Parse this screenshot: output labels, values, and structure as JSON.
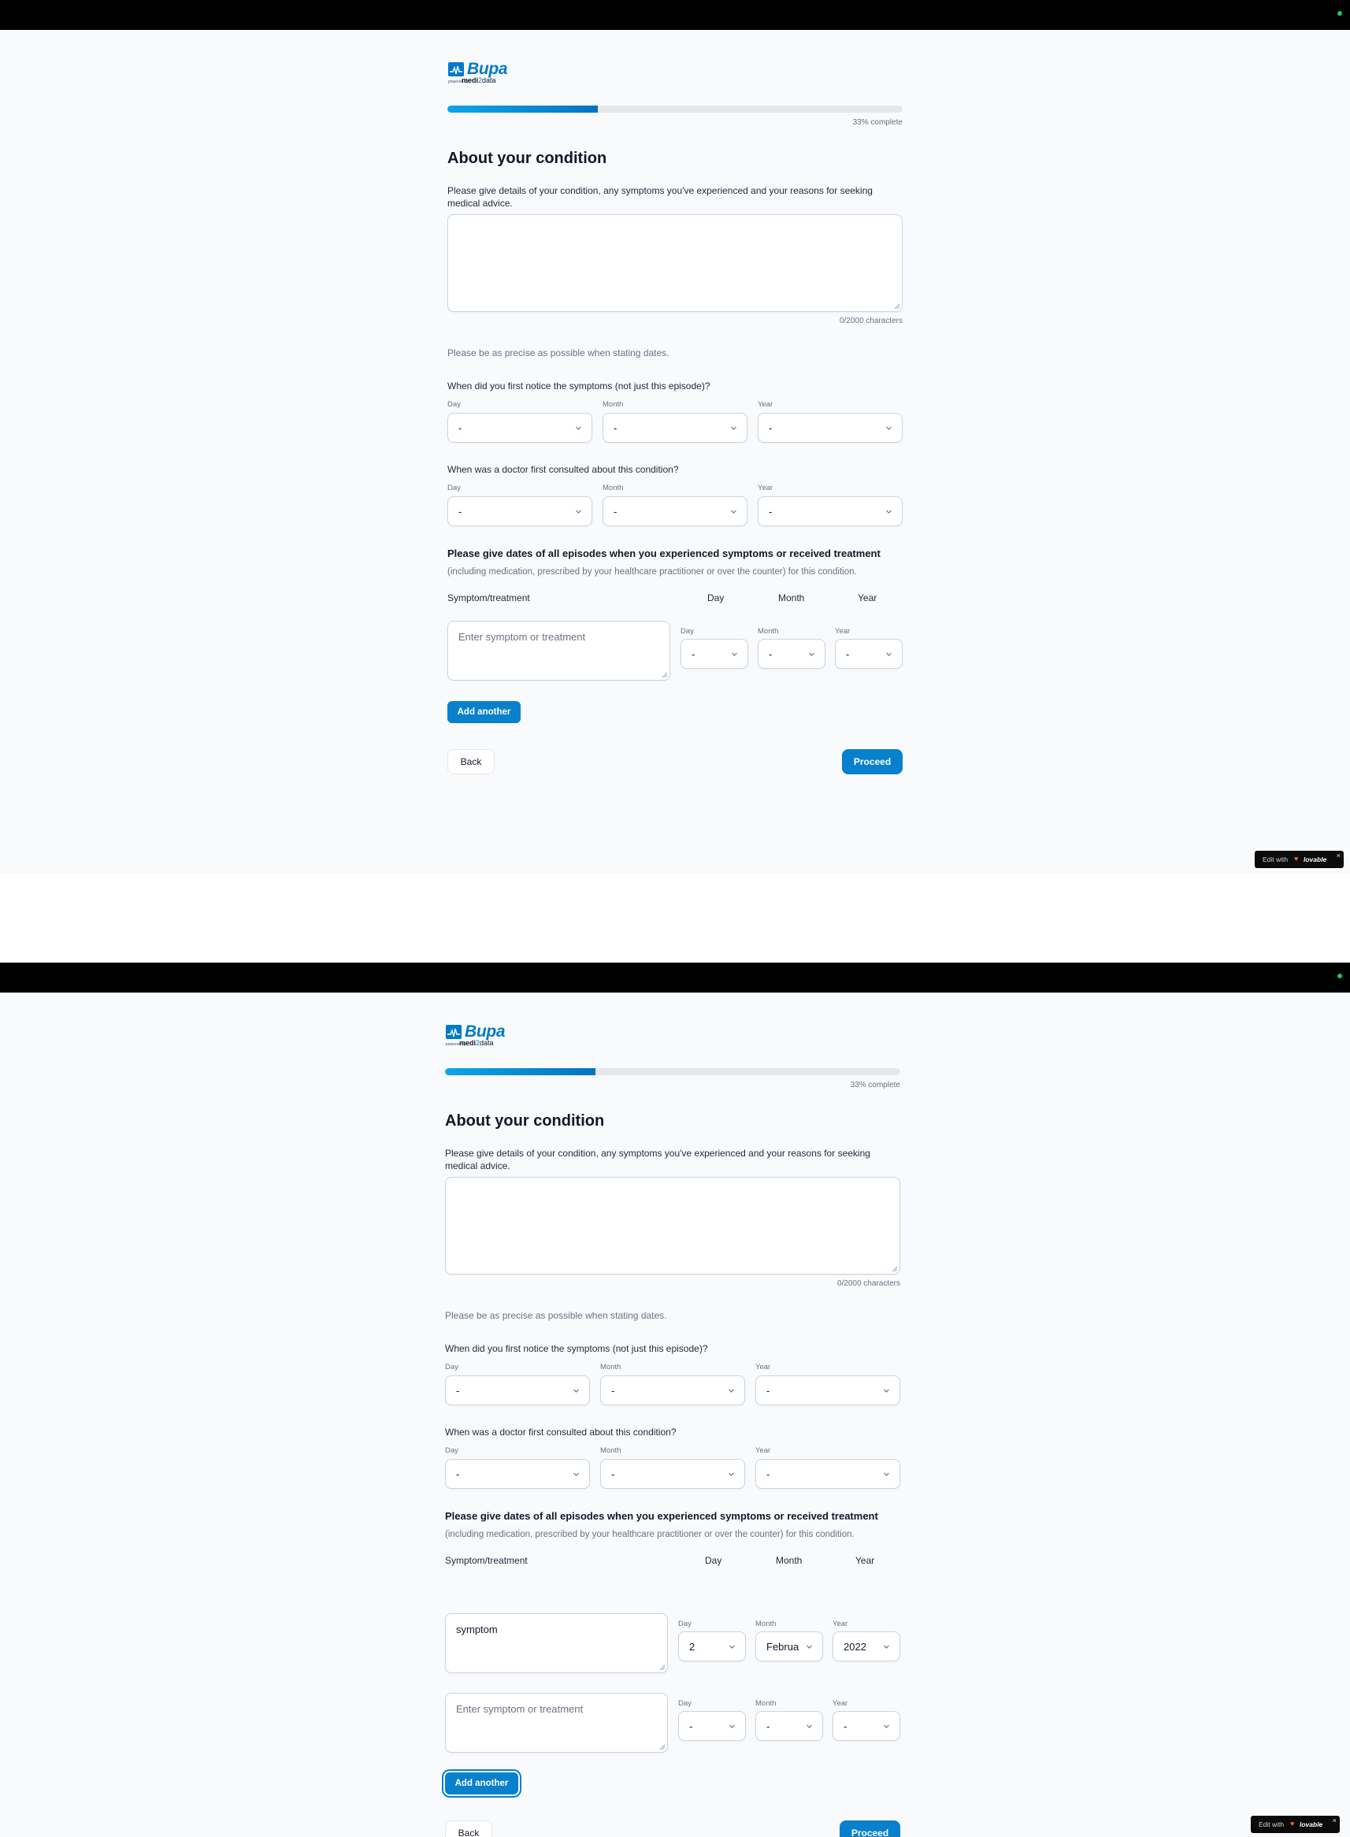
{
  "brand": {
    "name": "Bupa",
    "powered_by": "powered by",
    "partner_bold": "medi",
    "partner_mark": "2",
    "partner_rest": "data",
    "color": "#0079c8"
  },
  "progress": {
    "percent": 33,
    "text": "33% complete"
  },
  "page_title": "About your condition",
  "details": {
    "label": "Please give details of your condition, any symptoms you've experienced and your reasons for seeking medical advice.",
    "value": "",
    "counter": "0/2000 characters"
  },
  "dates_hint": "Please be as precise as possible when stating dates.",
  "date_labels": {
    "day": "Day",
    "month": "Month",
    "year": "Year"
  },
  "first_noticed": {
    "question": "When did you first notice the symptoms (not just this episode)?",
    "day": "-",
    "month": "-",
    "year": "-"
  },
  "doctor_consulted": {
    "question": "When was a doctor first consulted about this condition?",
    "day": "-",
    "month": "-",
    "year": "-"
  },
  "episodes": {
    "title": "Please give dates of all episodes when you experienced symptoms or received treatment",
    "subtitle": "(including medication, prescribed by your healthcare practitioner or over the counter) for this condition.",
    "headers": {
      "symptom": "Symptom/treatment",
      "day": "Day",
      "month": "Month",
      "year": "Year"
    },
    "placeholder": "Enter symptom or treatment"
  },
  "screen1_episodes": [
    {
      "text": "",
      "day": "-",
      "month": "-",
      "year": "-"
    }
  ],
  "screen2_episodes": [
    {
      "text": "symptom",
      "day": "2",
      "month": "February",
      "year": "2022"
    },
    {
      "text": "",
      "day": "-",
      "month": "-",
      "year": "-"
    }
  ],
  "buttons": {
    "add_another": "Add another",
    "back": "Back",
    "proceed": "Proceed"
  },
  "lovable": {
    "prefix": "Edit with",
    "brand": "lovable",
    "close": "×"
  },
  "colors": {
    "primary": "#0880cc",
    "topbar": "#000000",
    "status_dot": "#22c55e"
  }
}
